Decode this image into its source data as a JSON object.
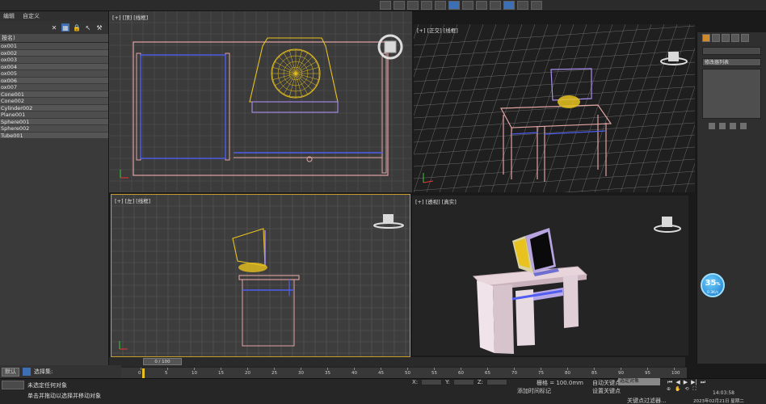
{
  "top_toolbar": {
    "icons": [
      "toolbar-icon-1",
      "toolbar-icon-2",
      "toolbar-icon-3",
      "toolbar-icon-4",
      "toolbar-icon-5",
      "toolbar-icon-6",
      "toolbar-icon-7",
      "toolbar-icon-8",
      "toolbar-icon-9",
      "toolbar-icon-10",
      "toolbar-icon-11",
      "toolbar-icon-12"
    ]
  },
  "scene_explorer": {
    "menu": [
      "编辑",
      "自定义"
    ],
    "header": "按名)",
    "items": [
      "ox001",
      "ox002",
      "ox003",
      "ox004",
      "ox005",
      "ox006",
      "ox007",
      "Cone001",
      "Cone002",
      "Cylinder002",
      "Plane001",
      "Sphere001",
      "Sphere002",
      "Tube001"
    ],
    "bottom_dropdown": "默认",
    "bottom_label": "选择集:"
  },
  "viewports": {
    "top": {
      "label": "[+] [顶] [线框]"
    },
    "perspective": {
      "label": "[+] [正交] [线框]"
    },
    "left": {
      "label": "[+] [左] [线框]"
    },
    "camera": {
      "label": "[+] [透视] [真实]"
    }
  },
  "command_panel": {
    "dropdown": "修改器列表",
    "badge_value": "35",
    "badge_unit": "%",
    "badge_sub": "0.3K/s"
  },
  "timeline": {
    "range_label": "0 / 100",
    "ticks": [
      "0",
      "5",
      "10",
      "15",
      "20",
      "25",
      "30",
      "35",
      "40",
      "45",
      "50",
      "55",
      "60",
      "65",
      "70",
      "75",
      "80",
      "85",
      "90",
      "95",
      "100"
    ]
  },
  "status": {
    "line1": "未选定任何对象",
    "line2": "单击并拖动以选择并移动对象",
    "grid": "栅格 = 100.0mm",
    "add_time_tag": "添加时间标记",
    "auto_key": "自动关键点",
    "auto_key_select": "选定对象",
    "set_key": "设置关键点",
    "key_filter": "关键点过滤器...",
    "time": "14:03:58",
    "date": "2023年02月21日 星期二"
  },
  "colors": {
    "accent": "#3c6fb3",
    "active_viewport": "#c79a2c",
    "table_wire": "#e3a4a4",
    "monitor_wire": "#a98df0",
    "fan_wire": "#e8c21e"
  }
}
